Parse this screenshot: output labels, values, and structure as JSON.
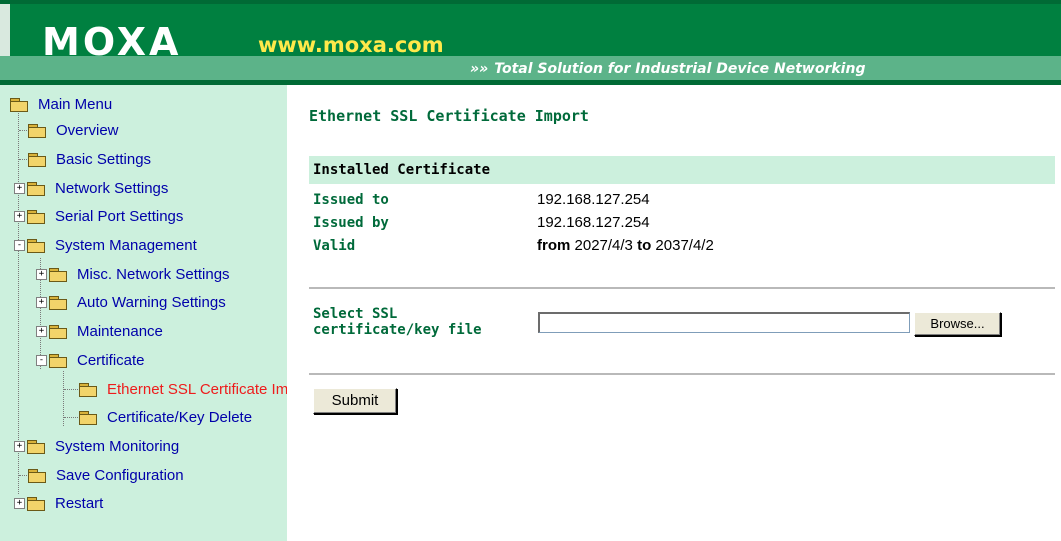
{
  "header": {
    "logo": "MOXA",
    "url": "www.moxa.com",
    "tagline_arrows": "»»",
    "tagline": "Total Solution for Industrial Device Networking"
  },
  "sidebar": {
    "items": [
      {
        "label": "Main Menu"
      },
      {
        "label": "Overview"
      },
      {
        "label": "Basic Settings"
      },
      {
        "label": "Network Settings"
      },
      {
        "label": "Serial Port Settings"
      },
      {
        "label": "System Management"
      },
      {
        "label": "Misc. Network Settings"
      },
      {
        "label": "Auto Warning Settings"
      },
      {
        "label": "Maintenance"
      },
      {
        "label": "Certificate"
      },
      {
        "label": "Ethernet SSL Certificate Import"
      },
      {
        "label": "Certificate/Key Delete"
      },
      {
        "label": "System Monitoring"
      },
      {
        "label": "Save Configuration"
      },
      {
        "label": "Restart"
      }
    ],
    "active_color": "#ee1c1c"
  },
  "main": {
    "title": "Ethernet SSL Certificate Import",
    "installed_header": "Installed Certificate",
    "issued_to_label": "Issued to",
    "issued_to_value": "192.168.127.254",
    "issued_by_label": "Issued by",
    "issued_by_value": "192.168.127.254",
    "valid_label": "Valid",
    "valid_from_word": "from",
    "valid_from_date": "2027/4/3",
    "valid_to_word": "to",
    "valid_to_date": "2037/4/2",
    "select_label_line1": "Select SSL",
    "select_label_line2": "certificate/key file",
    "file_value": "",
    "browse_label": "Browse...",
    "submit_label": "Submit"
  },
  "colors": {
    "brand_green": "#008040",
    "sidebar_bg": "#ccf0dd",
    "label_green": "#006a3a",
    "link_blue": "#0000aa"
  }
}
